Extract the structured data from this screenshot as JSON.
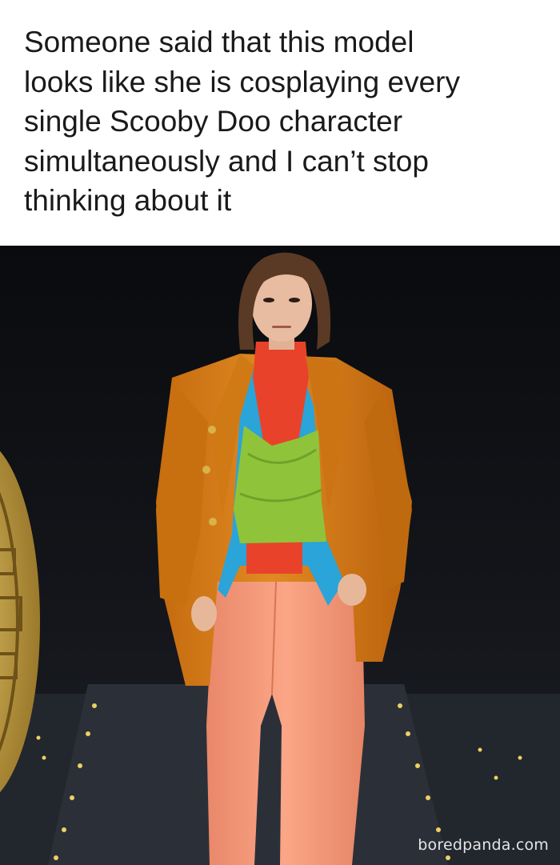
{
  "meme": {
    "caption": "Someone said that this model\nlooks like she is cosplaying every\nsingle Scooby Doo character\nsimultaneously and I can’t stop\nthinking about it",
    "watermark": "boredpanda.com"
  },
  "colors": {
    "background": "#ffffff",
    "caption_text": "#1a1a1a",
    "backdrop": "#0c0d10",
    "jacket": "#d9801a",
    "turtleneck": "#e8432a",
    "blouse": "#2aa4d9",
    "top": "#8fc43a",
    "trousers": "#f59a78",
    "coin": "#c9a445"
  }
}
